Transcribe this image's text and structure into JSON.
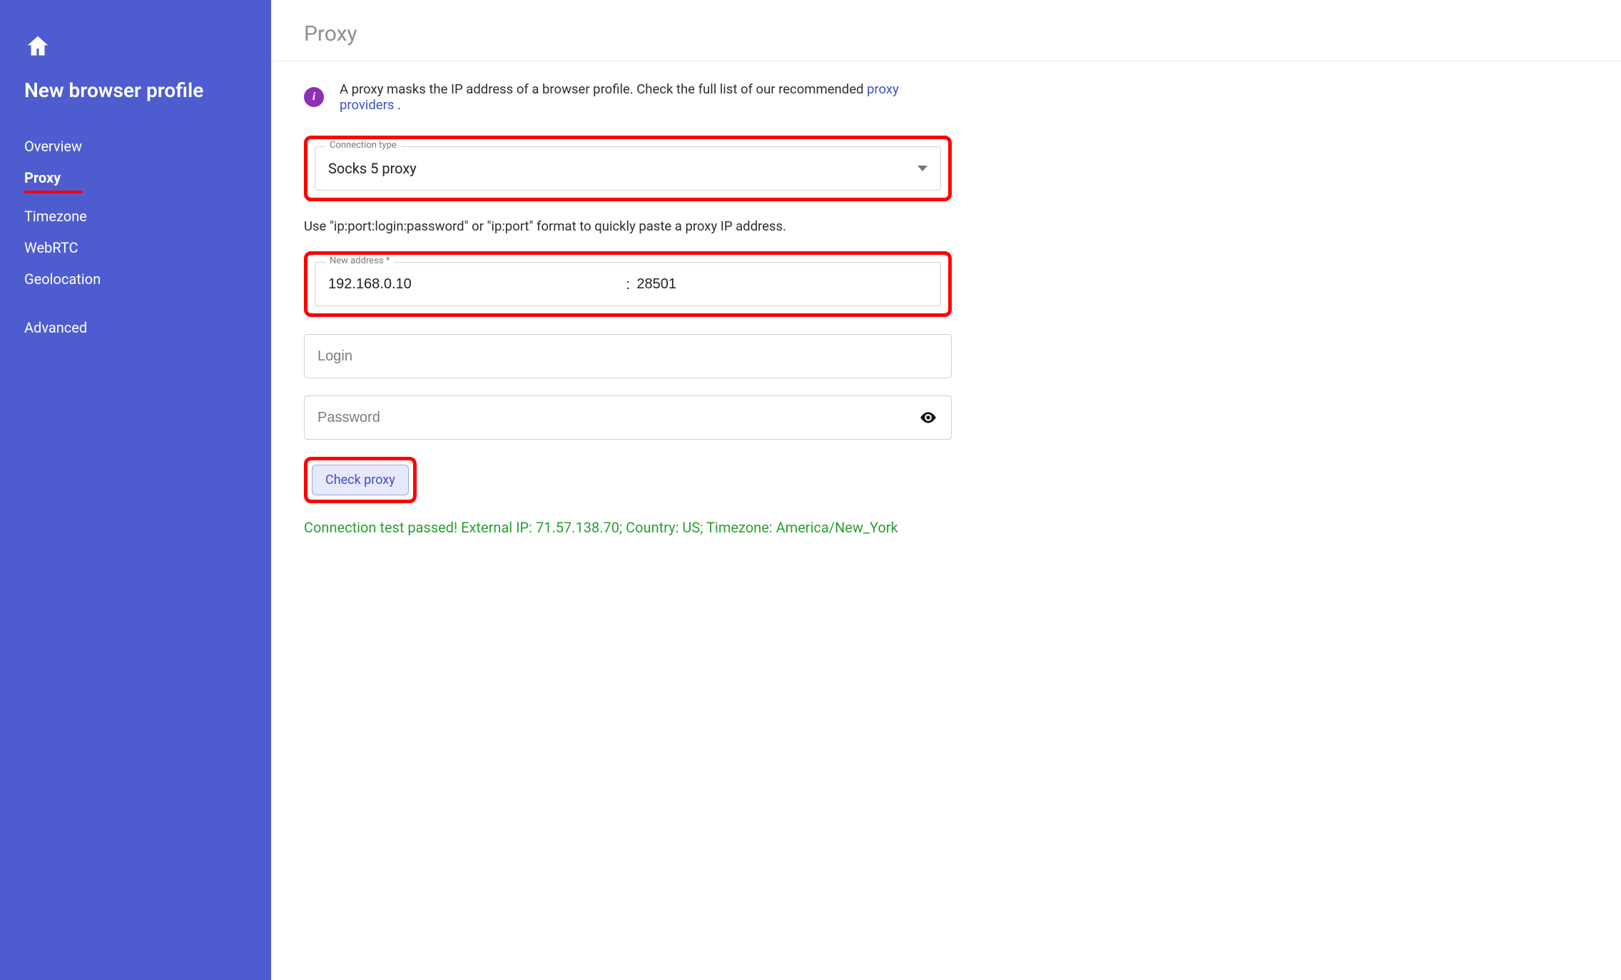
{
  "sidebar": {
    "title": "New browser profile",
    "items": [
      {
        "label": "Overview",
        "active": false
      },
      {
        "label": "Proxy",
        "active": true
      },
      {
        "label": "Timezone",
        "active": false
      },
      {
        "label": "WebRTC",
        "active": false
      },
      {
        "label": "Geolocation",
        "active": false
      }
    ],
    "extras": [
      {
        "label": "Advanced"
      }
    ]
  },
  "header": {
    "title": "Proxy"
  },
  "info": {
    "text_before_link": "A proxy masks the IP address of a browser profile. Check the full list of our recommended ",
    "link_text": "proxy providers",
    "text_after_link": " ."
  },
  "connection_type": {
    "label": "Connection type",
    "value": "Socks 5 proxy"
  },
  "paste_hint": "Use \"ip:port:login:password\" or \"ip:port\" format to quickly paste a proxy IP address.",
  "address": {
    "label": "New address *",
    "host": "192.168.0.10",
    "separator": ":",
    "port": "28501"
  },
  "login": {
    "placeholder": "Login",
    "value": ""
  },
  "password": {
    "placeholder": "Password",
    "value": ""
  },
  "check_button": {
    "label": "Check proxy"
  },
  "status": {
    "text": "Connection test passed! External IP: 71.57.138.70; Country: US; Timezone: America/New_York"
  }
}
